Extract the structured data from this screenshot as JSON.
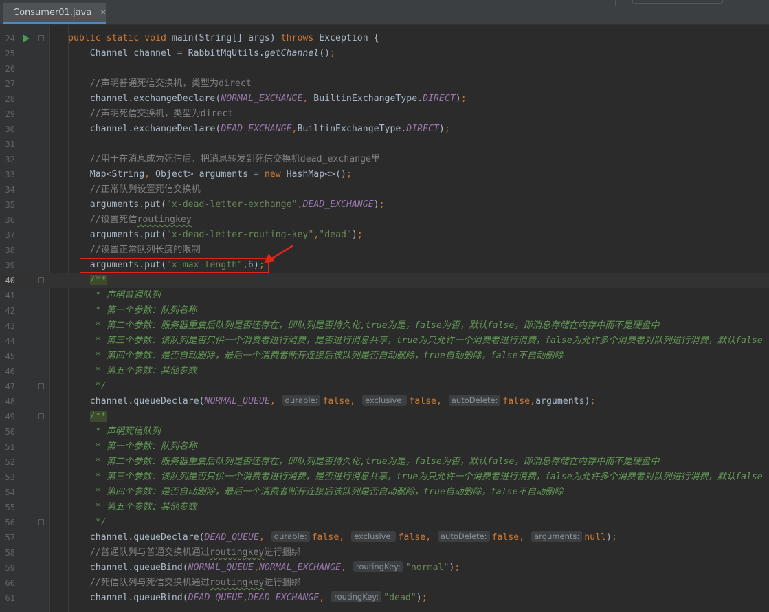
{
  "tab": {
    "label": "Consumer01.java",
    "close": "✕",
    "icon": "java-class-icon"
  },
  "lines": [
    {
      "n": "24",
      "run": true,
      "fold": true,
      "html": "<span class=\"kw\">public static void </span>main(String[] args) <span class=\"kw\">throws </span>Exception {"
    },
    {
      "n": "25",
      "html": "    Channel channel = RabbitMqUtils.<span class=\"sm\">getChannel</span>()<span class=\"kw\">;</span>"
    },
    {
      "n": "26",
      "html": ""
    },
    {
      "n": "27",
      "html": "    <span class=\"cm\">//声明普通死信交换机，类型为direct</span>"
    },
    {
      "n": "28",
      "html": "    channel.exchangeDeclare(<span class=\"cst\">NORMAL_EXCHANGE</span><span class=\"kw\">, </span>BuiltinExchangeType.<span class=\"cst\">DIRECT</span>)<span class=\"kw\">;</span>"
    },
    {
      "n": "29",
      "html": "    <span class=\"cm\">//声明死信交换机，类型为direct</span>"
    },
    {
      "n": "30",
      "html": "    channel.exchangeDeclare(<span class=\"cst\">DEAD_EXCHANGE</span><span class=\"kw\">,</span>BuiltinExchangeType.<span class=\"cst\">DIRECT</span>)<span class=\"kw\">;</span>"
    },
    {
      "n": "31",
      "html": ""
    },
    {
      "n": "32",
      "html": "    <span class=\"cm\">//用于在消息成为死信后，把消息转发到死信交换机dead_exchange里</span>"
    },
    {
      "n": "33",
      "html": "    Map&lt;String<span class=\"kw\">, </span>Object&gt; arguments = <span class=\"kw\">new </span>HashMap&lt;&gt;()<span class=\"kw\">;</span>"
    },
    {
      "n": "34",
      "html": "    <span class=\"cm\">//正常队列设置死信交换机</span>"
    },
    {
      "n": "35",
      "html": "    arguments.put(<span class=\"str\">\"x-dead-letter-exchange\"</span><span class=\"kw\">,</span><span class=\"cst\">DEAD_EXCHANGE</span>)<span class=\"kw\">;</span>"
    },
    {
      "n": "36",
      "html": "    <span class=\"cm\">//设置死信<span class=\"squig\">routingkey</span></span>"
    },
    {
      "n": "37",
      "html": "    arguments.put(<span class=\"str\">\"x-dead-letter-routing-key\"</span><span class=\"kw\">,</span><span class=\"str\">\"dead\"</span>)<span class=\"kw\">;</span>"
    },
    {
      "n": "38",
      "html": "    <span class=\"cm\">//设置正常队列长度的限制</span>"
    },
    {
      "n": "39",
      "html": "    arguments.put(<span class=\"str\">\"x-max-length\"</span><span class=\"kw\">,</span><span class=\"num\">6</span>)<span class=\"kw\">;</span>"
    },
    {
      "n": "40",
      "current": true,
      "fold": true,
      "html": "    <span class=\"doc\"><span class=\"dhl\">/**</span></span>"
    },
    {
      "n": "41",
      "html": "<span class=\"doc\">     * 声明普通队列</span>"
    },
    {
      "n": "42",
      "html": "<span class=\"doc\">     * 第一个参数：队列名称</span>"
    },
    {
      "n": "43",
      "html": "<span class=\"doc\">     * 第二个参数：服务器重启后队列是否还存在，即队列是否持久化,true为是，false为否，默认false，即消息存储在内存中而不是硬盘中</span>"
    },
    {
      "n": "44",
      "html": "<span class=\"doc\">     * 第三个参数：该队列是否只供一个消费者进行消费，是否进行消息共享，true为只允许一个消费者进行消费，false为允许多个消费者对队列进行消费，默认false</span>"
    },
    {
      "n": "45",
      "html": "<span class=\"doc\">     * 第四个参数：是否自动删除，最后一个消费者断开连接后该队列是否自动删除，true自动删除，false不自动删除</span>"
    },
    {
      "n": "46",
      "html": "<span class=\"doc\">     * 第五个参数：其他参数</span>"
    },
    {
      "n": "47",
      "fold": true,
      "html": "<span class=\"doc\">     */</span>"
    },
    {
      "n": "48",
      "html": "    channel.queueDeclare(<span class=\"cst\">NORMAL_QUEUE</span><span class=\"kw\">, </span><span class=\"hint\">durable:</span><span class=\"kw\">false, </span><span class=\"hint\">exclusive:</span><span class=\"kw\">false, </span><span class=\"hint\">autoDelete:</span><span class=\"kw\">false,</span>arguments)<span class=\"kw\">;</span>"
    },
    {
      "n": "49",
      "fold": true,
      "html": "    <span class=\"doc\"><span class=\"dhl\">/**</span></span>"
    },
    {
      "n": "50",
      "html": "<span class=\"doc\">     * 声明死信队列</span>"
    },
    {
      "n": "51",
      "html": "<span class=\"doc\">     * 第一个参数：队列名称</span>"
    },
    {
      "n": "52",
      "html": "<span class=\"doc\">     * 第二个参数：服务器重启后队列是否还存在，即队列是否持久化,true为是，false为否，默认false，即消息存储在内存中而不是硬盘中</span>"
    },
    {
      "n": "53",
      "html": "<span class=\"doc\">     * 第三个参数：该队列是否只供一个消费者进行消费，是否进行消息共享，true为只允许一个消费者进行消费，false为允许多个消费者对队列进行消费，默认false</span>"
    },
    {
      "n": "54",
      "html": "<span class=\"doc\">     * 第四个参数：是否自动删除，最后一个消费者断开连接后该队列是否自动删除，true自动删除，false不自动删除</span>"
    },
    {
      "n": "55",
      "html": "<span class=\"doc\">     * 第五个参数：其他参数</span>"
    },
    {
      "n": "56",
      "fold": true,
      "html": "<span class=\"doc\">     */</span>"
    },
    {
      "n": "57",
      "html": "    channel.queueDeclare(<span class=\"cst\">DEAD_QUEUE</span><span class=\"kw\">, </span><span class=\"hint\">durable:</span><span class=\"kw\">false, </span><span class=\"hint\">exclusive:</span><span class=\"kw\">false, </span><span class=\"hint\">autoDelete:</span><span class=\"kw\">false, </span><span class=\"hint\">arguments:</span><span class=\"kw\">null</span>)<span class=\"kw\">;</span>"
    },
    {
      "n": "58",
      "html": "    <span class=\"cm\">//普通队列与普通交换机通过<span class=\"squig\">routingkey</span>进行捆绑</span>"
    },
    {
      "n": "59",
      "html": "    channel.queueBind(<span class=\"cst\">NORMAL_QUEUE</span><span class=\"kw\">,</span><span class=\"cst\">NORMAL_EXCHANGE</span><span class=\"kw\">, </span><span class=\"hint\">routingKey:</span><span class=\"str\">\"normal\"</span>)<span class=\"kw\">;</span>"
    },
    {
      "n": "60",
      "html": "    <span class=\"cm\">//死信队列与死信交换机通过<span class=\"squig\">routingkey</span>进行捆绑</span>"
    },
    {
      "n": "61",
      "html": "    channel.queueBind(<span class=\"cst\">DEAD_QUEUE</span><span class=\"kw\">,</span><span class=\"cst\">DEAD_EXCHANGE</span><span class=\"kw\">, </span><span class=\"hint\">routingKey:</span><span class=\"str\">\"dead\"</span>)<span class=\"kw\">;</span>"
    }
  ],
  "annotation": {
    "highlight_line": "39",
    "color": "#e0231d"
  }
}
